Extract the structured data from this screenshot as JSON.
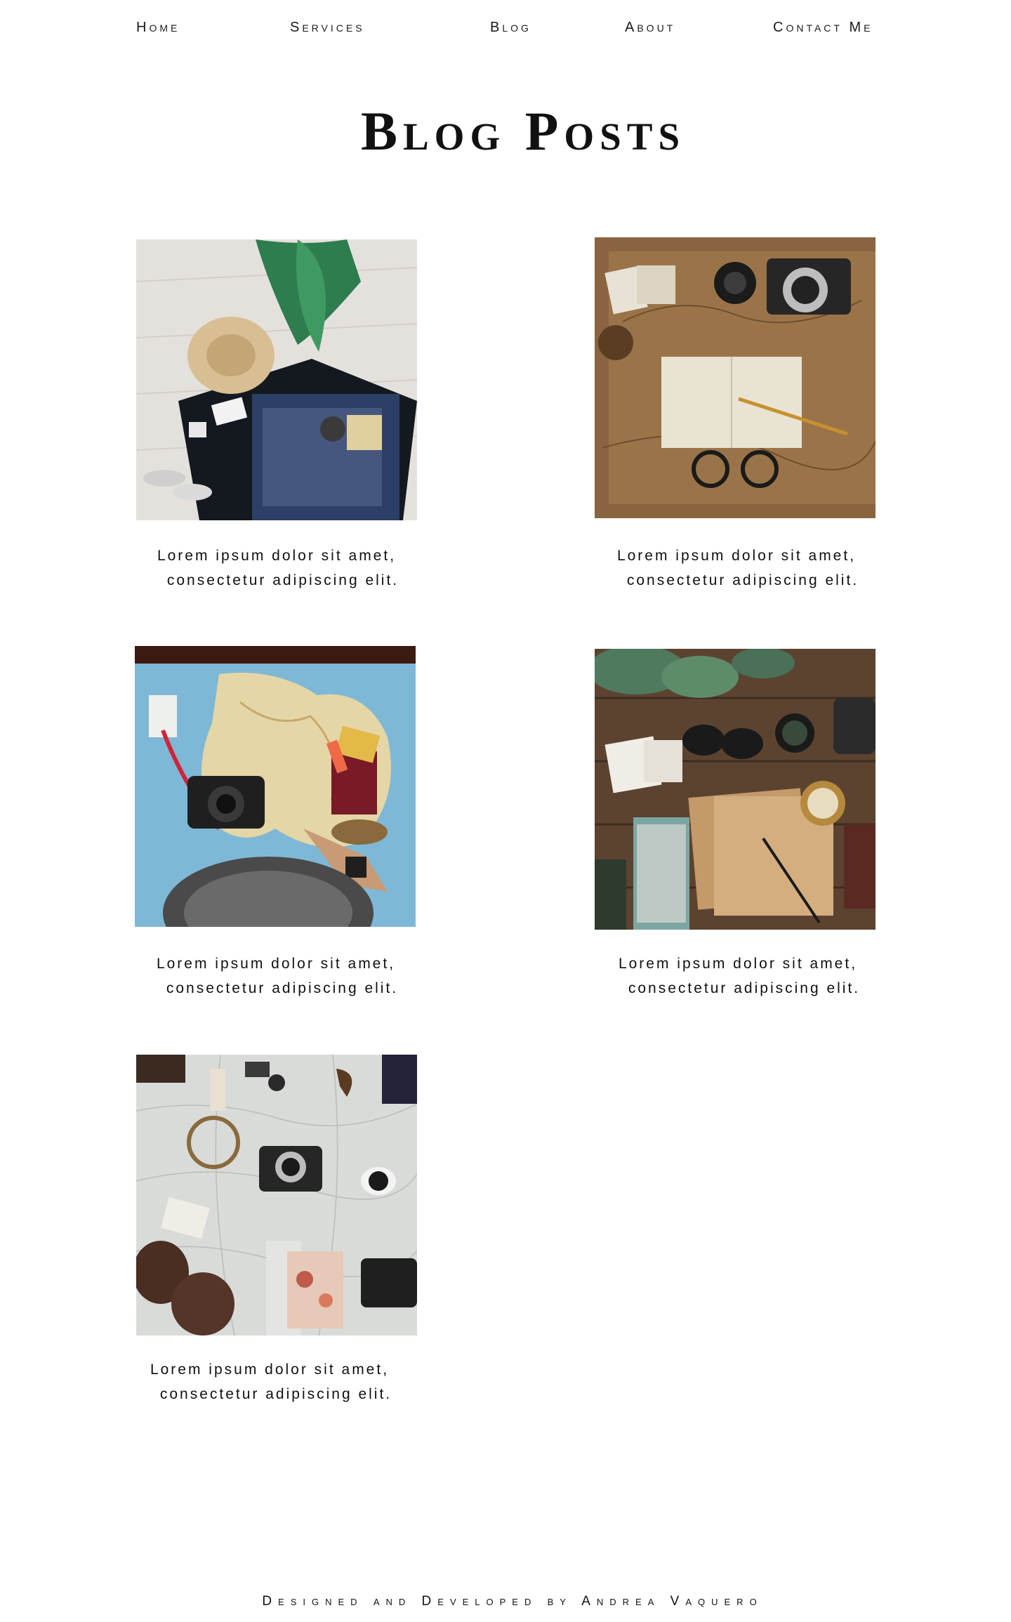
{
  "nav": {
    "home": "Home",
    "services": "Services",
    "blog": "Blog",
    "about": "About",
    "contact": "Contact Me"
  },
  "page": {
    "title": "Blog Posts"
  },
  "posts": [
    {
      "line1": "Lorem ipsum dolor sit amet,",
      "line2": "consectetur adipiscing elit.",
      "image": "suitcase-hat-plant-photo"
    },
    {
      "line1": "Lorem ipsum dolor sit amet,",
      "line2": "consectetur adipiscing elit.",
      "image": "camera-notebook-map-photo"
    },
    {
      "line1": "Lorem ipsum dolor sit amet,",
      "line2": "consectetur adipiscing elit.",
      "image": "australia-map-camera-passport-photo"
    },
    {
      "line1": "Lorem ipsum dolor sit amet,",
      "line2": "consectetur adipiscing elit.",
      "image": "wood-table-compass-notes-photo"
    },
    {
      "line1": "Lorem ipsum dolor sit amet,",
      "line2": "consectetur adipiscing elit.",
      "image": "map-boots-cameras-photo"
    }
  ],
  "footer": {
    "credit": "Designed and Developed by Andrea Vaquero"
  },
  "colors": {
    "text": "#111111",
    "background": "#ffffff"
  }
}
